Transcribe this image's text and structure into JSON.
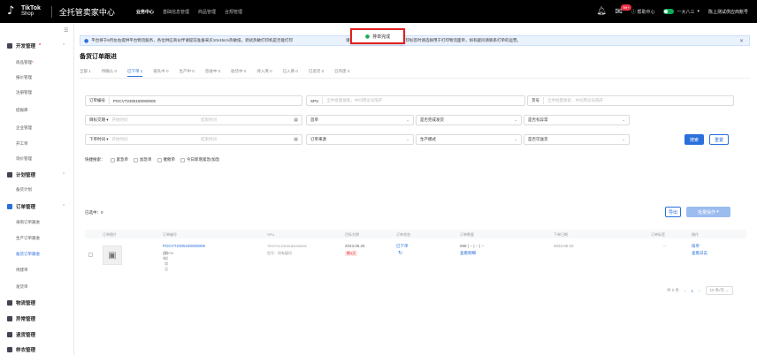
{
  "topbar": {
    "logo_line1": "TikTok",
    "logo_line2": "Shop",
    "app_title": "全托管卖家中心",
    "nav": [
      "业务中心",
      "基础信息管理",
      "商品管理",
      "合规管理"
    ],
    "badge": "99+",
    "help": "帮助中心",
    "shop": "一大八三",
    "user": "陈上测试供应商账号"
  },
  "sidebar": {
    "groups": [
      {
        "label": "开发管理",
        "required": true,
        "items": [
          "商品管理",
          "报价管理",
          "注册管理",
          "提报库",
          "企业管理",
          "开工单",
          "询价管理"
        ],
        "active_item": null
      },
      {
        "label": "计划管理",
        "items": [
          "备货计划"
        ]
      },
      {
        "label": "订单管理",
        "items": [
          "采购订单跟进",
          "生产订单跟进",
          "备货订单跟进",
          "待建单",
          "发货单"
        ],
        "active_item": "备货订单跟进"
      },
      {
        "label": "物流管理",
        "items": []
      },
      {
        "label": "异常管理",
        "items": []
      },
      {
        "label": "退货管理",
        "items": []
      },
      {
        "label": "样衣管理",
        "items": []
      }
    ]
  },
  "notice": {
    "text": "平台将于8月左右提供平台物流服务，各位供应商伙伴请提前准备采买10x15cm热敏纸，调试热敏打印机是否能打印",
    "tail": "请不要将标签每一份打印多次，打印标签时请选择用于打印物流面单，如有疑问请联系打单的运营。"
  },
  "toast": {
    "text": "排单完成"
  },
  "page": {
    "title": "备货订单跟进"
  },
  "tabs": [
    {
      "label": "全部 1"
    },
    {
      "label": "待确认 0"
    },
    {
      "label": "已下单 1",
      "active": true
    },
    {
      "label": "排队中 0"
    },
    {
      "label": "生产中 0"
    },
    {
      "label": "签收中 0"
    },
    {
      "label": "收货中 0"
    },
    {
      "label": "待入库 0"
    },
    {
      "label": "已入库 0"
    },
    {
      "label": "已退货 0"
    },
    {
      "label": "已作废 0"
    }
  ],
  "filters": {
    "order_no_label": "订单编号",
    "order_no_value": "POCVT2305180000005",
    "spu_label": "SPU",
    "spu_placeholder": "全件批量搜索，中间用逗号隔开",
    "sku_label": "货号",
    "sku_placeholder": "全件批量搜索，中间用逗号隔开",
    "deadline_label": "目标交期",
    "start_time": "开始时间",
    "end_time": "结束时间",
    "first_order_label": "首单",
    "completed_label": "是否完成发货",
    "abnormal_label": "是否有异常",
    "order_time_label": "下单时间",
    "source_label": "订单来源",
    "mode_label": "生产模式",
    "can_ship_label": "是否可送货",
    "search_btn": "搜索",
    "reset_btn": "重置"
  },
  "quick_search": {
    "label": "快捷搜索：",
    "options": [
      "紧急单",
      "加急单",
      "催催单",
      "今日新增紧急/加急"
    ]
  },
  "table": {
    "selected": "已选中：0",
    "export_btn": "导出",
    "batch_btn": "批量操作",
    "headers": [
      "订单图片",
      "订单编号",
      "SPU",
      "目标交期",
      "订单状态",
      "订单数量",
      "下单日期",
      "订单标签",
      "操作"
    ],
    "row": {
      "order_no": "POCVT2305180000005",
      "order_sub1": "首单",
      "order_sub2": "测试商品",
      "order_sub3": "OEM",
      "spu": "TESTSC2305180000005",
      "spu_sub": "型号：如有疑问",
      "deadline": "2023.05.25",
      "deadline_tag": "剩4天",
      "status": "已下单",
      "qty": "998 | -- | -- | --",
      "qty_link": "查看明细",
      "order_date": "2023.05.18",
      "tag": "--",
      "action1": "排单",
      "action2": "查看日志"
    }
  },
  "pager": {
    "total": "共 0 条",
    "page": "1",
    "size": "10 条/页"
  }
}
